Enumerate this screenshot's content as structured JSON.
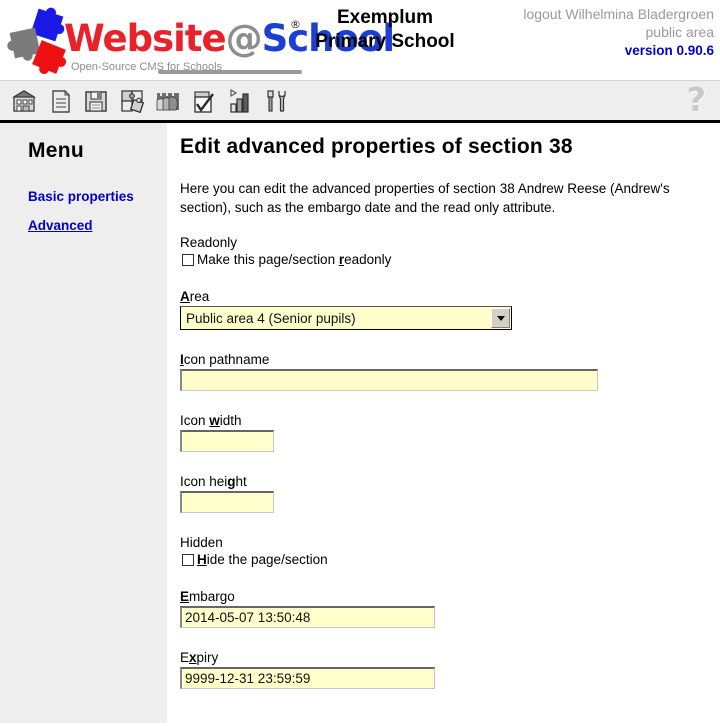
{
  "header": {
    "logo": {
      "wordmark_part1": "Website",
      "wordmark_at": "@",
      "wordmark_part2": "School",
      "registered_mark": "®",
      "tagline": "Open-Source CMS for Schools"
    },
    "school_name_line1": "Exemplum",
    "school_name_line2": "Primary School",
    "logout_text": "logout Wilhelmina Bladergroen",
    "area_text": "public area",
    "version_text": "version 0.90.6",
    "help_glyph": "?"
  },
  "toolbar": {
    "items": [
      {
        "name": "home-icon",
        "title": "Home"
      },
      {
        "name": "pages-icon",
        "title": "Pages"
      },
      {
        "name": "save-icon",
        "title": "Save"
      },
      {
        "name": "modules-icon",
        "title": "Modules"
      },
      {
        "name": "users-icon",
        "title": "Users"
      },
      {
        "name": "tasks-icon",
        "title": "Tasks"
      },
      {
        "name": "statistics-icon",
        "title": "Statistics"
      },
      {
        "name": "tools-icon",
        "title": "Tools"
      }
    ]
  },
  "sidebar": {
    "title": "Menu",
    "items": [
      {
        "label": "Basic properties",
        "active": false
      },
      {
        "label": "Advanced",
        "active": true
      }
    ]
  },
  "main": {
    "page_title": "Edit advanced properties of section 38",
    "intro": "Here you can edit the advanced properties of section 38 Andrew Reese (Andrew's section), such as the embargo date and the read only attribute.",
    "readonly": {
      "group_label": "Readonly",
      "checkbox_prefix": "Make this page/section ",
      "checkbox_accesskey": "r",
      "checkbox_suffix": "eadonly",
      "checked": false
    },
    "area": {
      "label_accesskey": "A",
      "label_rest": "rea",
      "selected": "Public area 4 (Senior pupils)"
    },
    "icon_pathname": {
      "label_accesskey": "I",
      "label_rest": "con pathname",
      "value": "",
      "placeholder": ""
    },
    "icon_width": {
      "label_prefix": "Icon ",
      "label_accesskey": "w",
      "label_rest": "idth",
      "value": "",
      "placeholder": ""
    },
    "icon_height": {
      "label_prefix": "Icon hei",
      "label_accesskey": "g",
      "label_rest": "ht",
      "value": "",
      "placeholder": ""
    },
    "hidden": {
      "group_label": "Hidden",
      "checkbox_accesskey": "H",
      "checkbox_suffix": "ide the page/section",
      "checked": false
    },
    "embargo": {
      "label_accesskey": "E",
      "label_rest": "mbargo",
      "value": "2014-05-07 13:50:48"
    },
    "expiry": {
      "label_prefix": "E",
      "label_accesskey": "x",
      "label_rest": "piry",
      "value": "9999-12-31 23:59:59"
    }
  },
  "colors": {
    "brand_red": "#e8212a",
    "brand_blue": "#1b3fd4",
    "brand_gray": "#8d8d8d",
    "link_blue": "#0000cc",
    "field_yellow": "#ffffcc",
    "sidebar_gray": "#eeeeee",
    "version_blue": "#0000d8"
  }
}
